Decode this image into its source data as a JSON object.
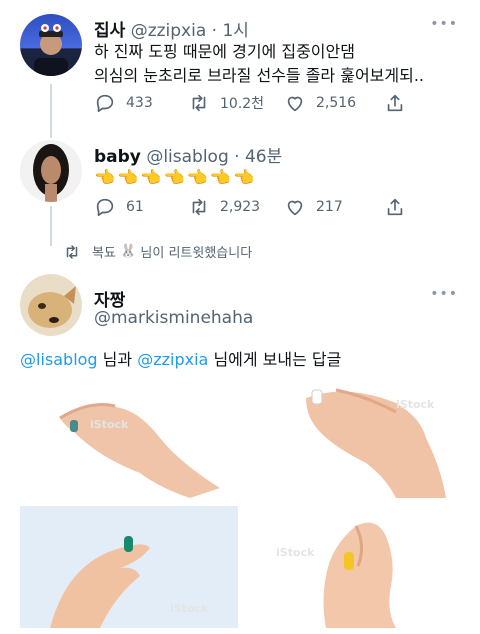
{
  "tweet1": {
    "name": "집사",
    "handle": "@zzipxia",
    "time": "1시",
    "lines": [
      "하 진짜 도핑 때문에 경기에 집중이안댐",
      "의심의 눈초리로 브라질 선수들 졸라 훑어보게되.."
    ],
    "reply_count": "433",
    "retweet_count": "10.2천",
    "like_count": "2,516",
    "more": "•••"
  },
  "tweet2": {
    "name": "baby",
    "handle": "@lisablog",
    "time": "46분",
    "emojis": "👈👈👈👈👈👈👈",
    "reply_count": "61",
    "retweet_count": "2,923",
    "like_count": "217"
  },
  "retweet_notice": {
    "prefix": "복됴",
    "emoji": "🐰",
    "suffix": "님이 리트윗했습니다"
  },
  "tweet3": {
    "name": "자짱",
    "handle": "@markisminehaha",
    "more": "•••",
    "mention1": "@lisablog",
    "text1": "님과",
    "mention2": "@zzipxia",
    "text2": "님에게 보내는 답글",
    "watermark": "iStock"
  },
  "colors": {
    "accent": "#1d9bf0",
    "muted": "#536471",
    "line": "#cfd9de",
    "pill_green": "#1e8a70",
    "pill_yellow": "#f3c623"
  },
  "icons": [
    "reply-icon",
    "retweet-icon",
    "like-icon",
    "share-icon"
  ]
}
